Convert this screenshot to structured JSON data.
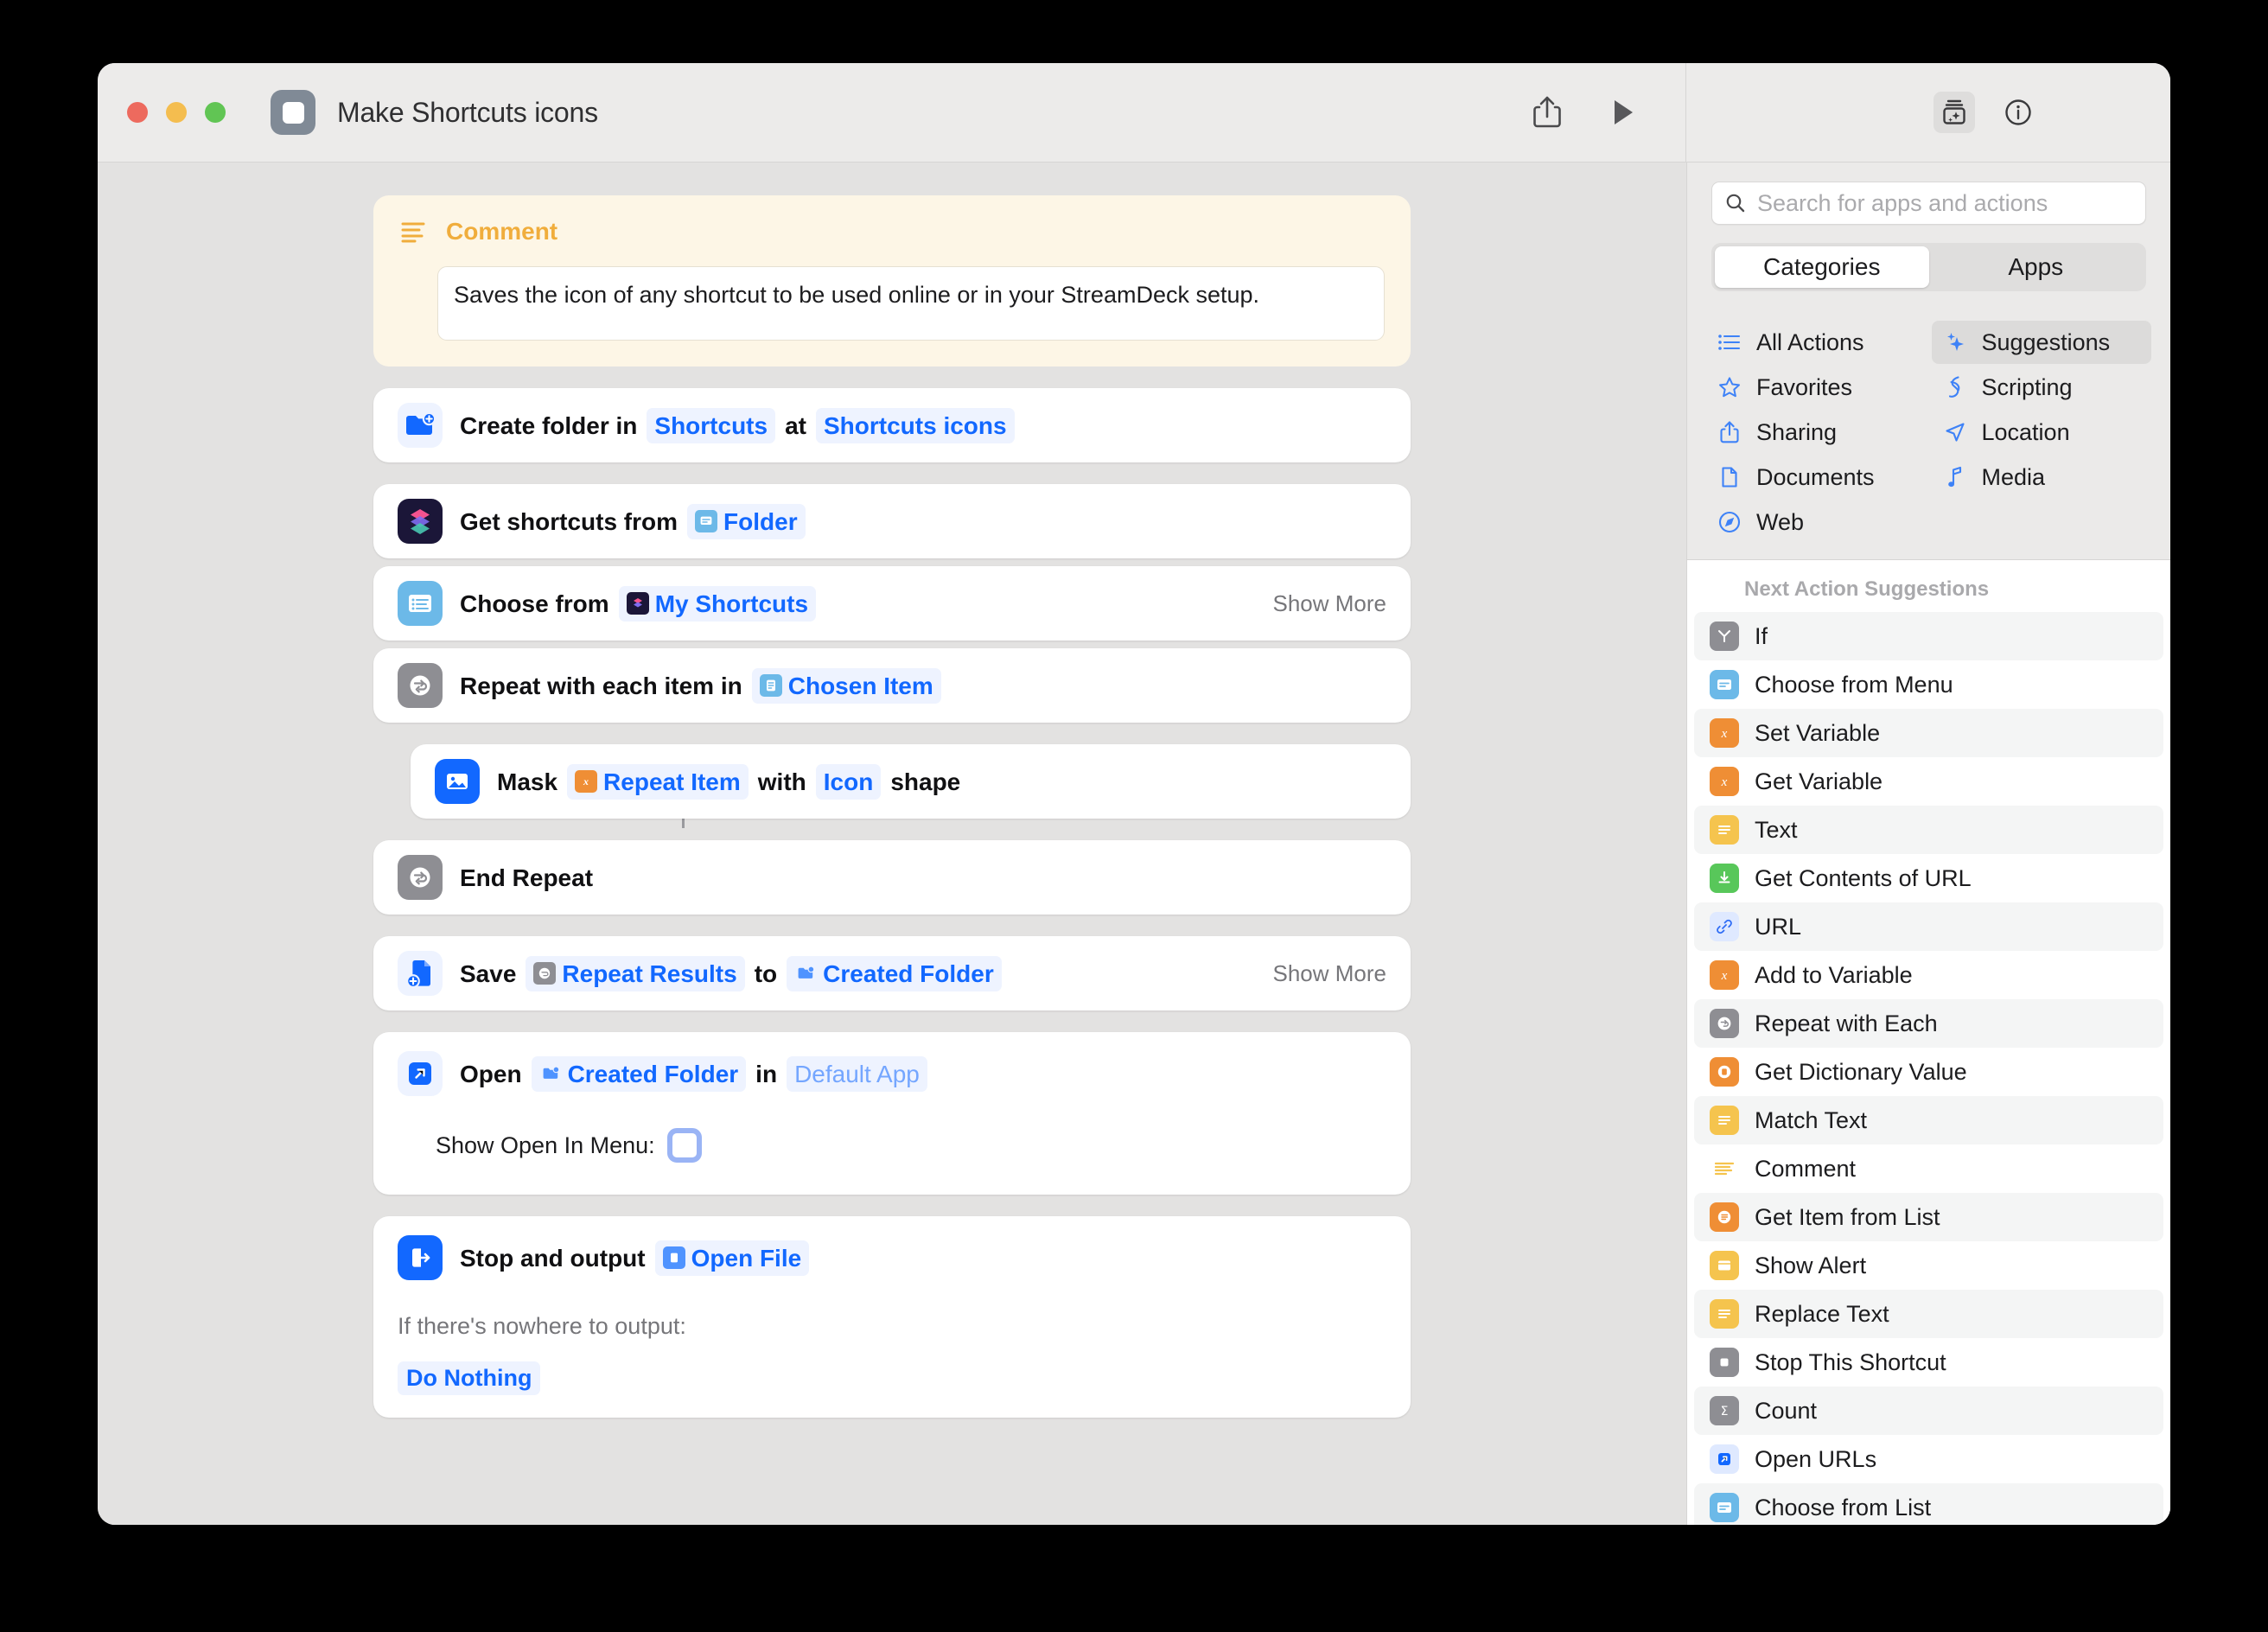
{
  "window": {
    "title": "Make Shortcuts icons",
    "traffic_lights": [
      "close",
      "minimize",
      "zoom"
    ],
    "toolbar": {
      "share_label": "share-icon",
      "run_label": "play-icon",
      "library_label": "action-library-icon",
      "info_label": "info-icon"
    }
  },
  "canvas": {
    "comment": {
      "title": "Comment",
      "text": "Saves the icon of any shortcut to be used online or in your StreamDeck setup."
    },
    "actions": [
      {
        "id": "create-folder",
        "icon": "folder-add-icon",
        "icon_bg": "#eef3ff",
        "parts": [
          {
            "type": "text",
            "value": "Create folder in",
            "bold": true
          },
          {
            "type": "token",
            "value": "Shortcuts",
            "icon": "none"
          },
          {
            "type": "text",
            "value": "at",
            "bold": true
          },
          {
            "type": "token",
            "value": "Shortcuts icons",
            "icon": "none"
          }
        ],
        "show_more": ""
      },
      {
        "id": "get-shortcuts-from",
        "icon": "shortcuts-app-icon",
        "icon_bg": "#1b1638",
        "parts": [
          {
            "type": "text",
            "value": "Get shortcuts from",
            "bold": true
          },
          {
            "type": "token",
            "value": "Folder",
            "icon": "menu-token-icon"
          }
        ],
        "show_more": ""
      },
      {
        "id": "choose-from",
        "icon": "choose-from-menu-icon",
        "icon_bg": "#6cb9e8",
        "parts": [
          {
            "type": "text",
            "value": "Choose from",
            "bold": true
          },
          {
            "type": "token",
            "value": "My Shortcuts",
            "icon": "shortcuts-token-icon"
          }
        ],
        "show_more": "Show More"
      },
      {
        "id": "repeat-with-each",
        "icon": "repeat-icon",
        "icon_bg": "#8e8e93",
        "parts": [
          {
            "type": "text",
            "value": "Repeat with each item in",
            "bold": true
          },
          {
            "type": "token",
            "value": "Chosen Item",
            "icon": "list-token-icon"
          }
        ],
        "show_more": ""
      },
      {
        "id": "mask-image",
        "icon": "image-mask-icon",
        "icon_bg": "#1268ff",
        "indent": true,
        "parts": [
          {
            "type": "text",
            "value": "Mask",
            "bold": true
          },
          {
            "type": "token",
            "value": "Repeat Item",
            "icon": "variable-token-icon"
          },
          {
            "type": "text",
            "value": "with",
            "bold": true
          },
          {
            "type": "token",
            "value": "Icon",
            "icon": "none"
          },
          {
            "type": "text",
            "value": "shape",
            "bold": true
          }
        ],
        "show_more": ""
      },
      {
        "id": "end-repeat",
        "icon": "repeat-icon",
        "icon_bg": "#8e8e93",
        "parts": [
          {
            "type": "text",
            "value": "End Repeat",
            "bold": true
          }
        ],
        "show_more": ""
      },
      {
        "id": "save-file",
        "icon": "save-file-icon",
        "icon_bg": "#eef3ff",
        "parts": [
          {
            "type": "text",
            "value": "Save",
            "bold": true
          },
          {
            "type": "token",
            "value": "Repeat Results",
            "icon": "repeat-token-icon"
          },
          {
            "type": "text",
            "value": "to",
            "bold": true
          },
          {
            "type": "token",
            "value": "Created Folder",
            "icon": "folder-token-icon"
          }
        ],
        "show_more": "Show More"
      },
      {
        "id": "open-file",
        "icon": "open-arrow-icon",
        "icon_bg": "#eef3ff",
        "parts": [
          {
            "type": "text",
            "value": "Open",
            "bold": true
          },
          {
            "type": "token",
            "value": "Created Folder",
            "icon": "folder-token-icon"
          },
          {
            "type": "text",
            "value": "in",
            "bold": true
          },
          {
            "type": "token",
            "value": "Default App",
            "icon": "none",
            "ghost": true
          }
        ],
        "show_more": "",
        "sub_label": "Show Open In Menu:",
        "sub_toggle": "off"
      },
      {
        "id": "stop-and-output",
        "icon": "stop-output-icon",
        "icon_bg": "#1268ff",
        "parts": [
          {
            "type": "text",
            "value": "Stop and output",
            "bold": true
          },
          {
            "type": "token",
            "value": "Open File",
            "icon": "file-token-icon"
          }
        ],
        "show_more": "",
        "sub_label": "If there's nowhere to output:",
        "sub_token": "Do Nothing"
      }
    ]
  },
  "sidebar": {
    "search": {
      "placeholder": "Search for apps and actions",
      "value": "",
      "icon": "search-icon"
    },
    "tabs": [
      {
        "label": "Categories",
        "active": true
      },
      {
        "label": "Apps",
        "active": false
      }
    ],
    "categories": [
      {
        "label": "All Actions",
        "icon": "list-bullet-icon",
        "active": false
      },
      {
        "label": "Suggestions",
        "icon": "sparkles-icon",
        "active": true
      },
      {
        "label": "Favorites",
        "icon": "star-icon",
        "active": false
      },
      {
        "label": "Scripting",
        "icon": "scripting-icon",
        "active": false
      },
      {
        "label": "Sharing",
        "icon": "share-icon",
        "active": false
      },
      {
        "label": "Location",
        "icon": "location-arrow-icon",
        "active": false
      },
      {
        "label": "Documents",
        "icon": "document-icon",
        "active": false
      },
      {
        "label": "Media",
        "icon": "music-note-icon",
        "active": false
      },
      {
        "label": "Web",
        "icon": "compass-icon",
        "active": false
      }
    ],
    "suggestions_header": "Next Action Suggestions",
    "suggestions": [
      {
        "label": "If",
        "icon": "if-branch-icon",
        "bg": "#8e8e93"
      },
      {
        "label": "Choose from Menu",
        "icon": "choose-menu-icon",
        "bg": "#6cb9e8"
      },
      {
        "label": "Set Variable",
        "icon": "variable-icon",
        "bg": "#ef8e35"
      },
      {
        "label": "Get Variable",
        "icon": "variable-icon",
        "bg": "#ef8e35"
      },
      {
        "label": "Text",
        "icon": "text-lines-icon",
        "bg": "#f5c councils"
      },
      {
        "label": "Get Contents of URL",
        "icon": "download-icon",
        "bg": "#58c75a"
      },
      {
        "label": "URL",
        "icon": "link-icon",
        "bg": "#dfe9ff"
      },
      {
        "label": "Add to Variable",
        "icon": "variable-icon",
        "bg": "#ef8e35"
      },
      {
        "label": "Repeat with Each",
        "icon": "repeat-icon",
        "bg": "#8e8e93"
      },
      {
        "label": "Get Dictionary Value",
        "icon": "dictionary-icon",
        "bg": "#ef8e35"
      },
      {
        "label": "Match Text",
        "icon": "text-lines-icon",
        "bg": "#f5c44e"
      },
      {
        "label": "Comment",
        "icon": "comment-lines-icon",
        "bg": "transparent"
      },
      {
        "label": "Get Item from List",
        "icon": "list-circle-icon",
        "bg": "#ef8e35"
      },
      {
        "label": "Show Alert",
        "icon": "alert-window-icon",
        "bg": "#f5c44e"
      },
      {
        "label": "Replace Text",
        "icon": "text-lines-icon",
        "bg": "#f5c44e"
      },
      {
        "label": "Stop This Shortcut",
        "icon": "stop-square-icon",
        "bg": "#8e8e93"
      },
      {
        "label": "Count",
        "icon": "sigma-icon",
        "bg": "#8e8e93"
      },
      {
        "label": "Open URLs",
        "icon": "open-arrow-icon",
        "bg": "#dfe9ff"
      },
      {
        "label": "Choose from List",
        "icon": "choose-menu-icon",
        "bg": "#6cb9e8"
      }
    ]
  },
  "colors": {
    "accent_blue": "#1268ff",
    "token_bg": "#eef3ff",
    "canvas_bg": "#e3e2e1",
    "comment_yellow": "#f0ad3c",
    "orange": "#ef8e35",
    "gray": "#8e8e93"
  }
}
